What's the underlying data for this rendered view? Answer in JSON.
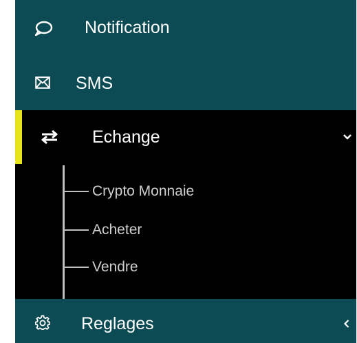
{
  "menu": {
    "notification": {
      "label": "Notification",
      "icon": "chat-bubble-icon"
    },
    "sms": {
      "label": "SMS",
      "icon": "envelope-icon"
    },
    "echange": {
      "label": "Echange",
      "icon": "swap-arrows-icon",
      "expanded": true,
      "children": [
        {
          "label": "Crypto Monnaie"
        },
        {
          "label": "Acheter"
        },
        {
          "label": "Vendre"
        }
      ]
    },
    "reglages": {
      "label": "Reglages",
      "icon": "gear-icon"
    }
  },
  "colors": {
    "teal": "#0d4b54",
    "active_bg": "#000000",
    "accent": "#e7e41c",
    "sub_text": "#cfcfcf"
  }
}
